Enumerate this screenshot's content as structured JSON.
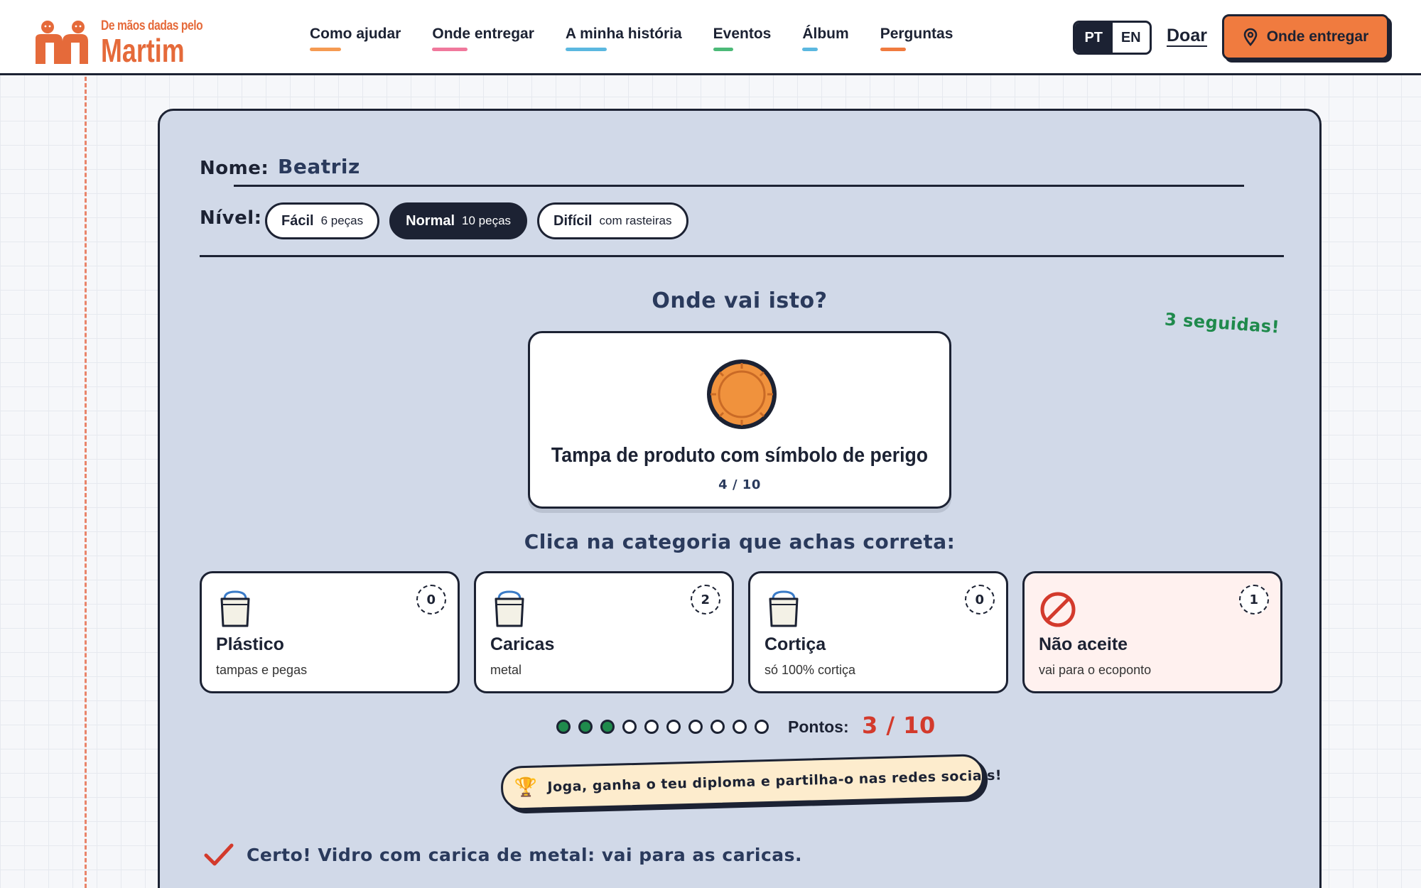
{
  "brand": {
    "tagline": "De mãos dadas pelo",
    "name": "Martim",
    "accent": "#e56a3a"
  },
  "nav": [
    {
      "label": "Como ajudar",
      "color": "#f59a52"
    },
    {
      "label": "Onde entregar",
      "color": "#f0789c"
    },
    {
      "label": "A minha história",
      "color": "#5bb8e0"
    },
    {
      "label": "Eventos",
      "color": "#4cba78"
    },
    {
      "label": "Álbum",
      "color": "#5bb8e0"
    },
    {
      "label": "Perguntas",
      "color": "#f07b3f"
    }
  ],
  "lang": {
    "pt": "PT",
    "en": "EN",
    "active": "PT"
  },
  "header_actions": {
    "donate": "Doar",
    "cta": "Onde entregar",
    "cta_icon": "map-pin-icon"
  },
  "form": {
    "name_label": "Nome:",
    "name_value": "Beatriz",
    "level_label": "Nível:",
    "levels": [
      {
        "name": "Fácil",
        "detail": "6 peças",
        "selected": false
      },
      {
        "name": "Normal",
        "detail": "10 peças",
        "selected": true
      },
      {
        "name": "Difícil",
        "detail": "com rasteiras",
        "selected": false
      }
    ]
  },
  "game": {
    "question": "Onde vai isto?",
    "streak": "3 seguidas!",
    "item": {
      "title": "Tampa de produto com símbolo de perigo",
      "counter": "4 / 10",
      "icon": "bottle-cap-icon"
    },
    "instruction": "Clica na categoria que achas correta:",
    "categories": [
      {
        "title": "Plástico",
        "subtitle": "tampas e pegas",
        "count": "0",
        "icon": "bucket-icon"
      },
      {
        "title": "Caricas",
        "subtitle": "metal",
        "count": "2",
        "icon": "bucket-icon"
      },
      {
        "title": "Cortiça",
        "subtitle": "só 100% cortiça",
        "count": "0",
        "icon": "bucket-icon"
      },
      {
        "title": "Não aceite",
        "subtitle": "vai para o ecoponto",
        "count": "1",
        "icon": "prohibited-icon"
      }
    ],
    "progress_done": 3,
    "progress_total": 10,
    "score_label": "Pontos:",
    "score": "3 / 10",
    "banner": "Joga, ganha o teu diploma e partilha-o nas redes sociais!",
    "feedback": "Certo! Vidro com carica de metal: vai para as caricas."
  }
}
